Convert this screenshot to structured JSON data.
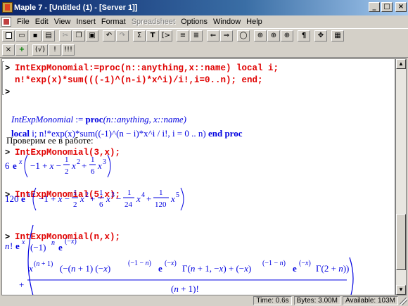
{
  "window": {
    "title": "Maple 7 - [Untitled (1) - [Server 1]]"
  },
  "window_buttons": [
    "_",
    "□",
    "×"
  ],
  "menu": [
    "File",
    "Edit",
    "View",
    "Insert",
    "Format",
    "Spreadsheet",
    "Options",
    "Window",
    "Help"
  ],
  "toolbar_main": [
    "new",
    "open",
    "save",
    "print",
    "cut",
    "copy",
    "paste",
    "undo",
    "redo",
    "Σ",
    "T",
    "[>",
    "indent",
    "outdent",
    "back",
    "forward",
    "stop",
    "zoom100",
    "zoom150",
    "zoom200",
    "¶",
    "expand",
    "restart"
  ],
  "toolbar_context": [
    "×",
    "+",
    "(√)",
    "!",
    "!!!"
  ],
  "worksheet": {
    "prompt": ">",
    "input1_line1": "IntExpMonomial:=proc(n::anything,x::name) local i;",
    "input1_line2": "n!*exp(x)*sum(((-1)^(n-i)*x^i)/i!,i=0..n); end;",
    "out_proc_name": "IntExpMonomial",
    "out_assign": " := ",
    "out_proc_kw": "proc",
    "out_proc_args": "(n::anything, x::name)",
    "out_local_kw": "local",
    "out_local_var": " i; ",
    "out_body": "n!*exp(x)*sum((-1)^(n − i)*x^i / i!, i = 0 .. n)",
    "out_end_kw": " end proc",
    "text_line": "Проверим ее в работе:",
    "input2": "IntExpMonomial(3,x);",
    "input3": "IntExpMonomial(5,x);",
    "input4": "IntExpMonomial(n,x);"
  },
  "status": {
    "time": "Time:  0.6s",
    "bytes": "Bytes: 3.00M",
    "available": "Available: 103M"
  }
}
